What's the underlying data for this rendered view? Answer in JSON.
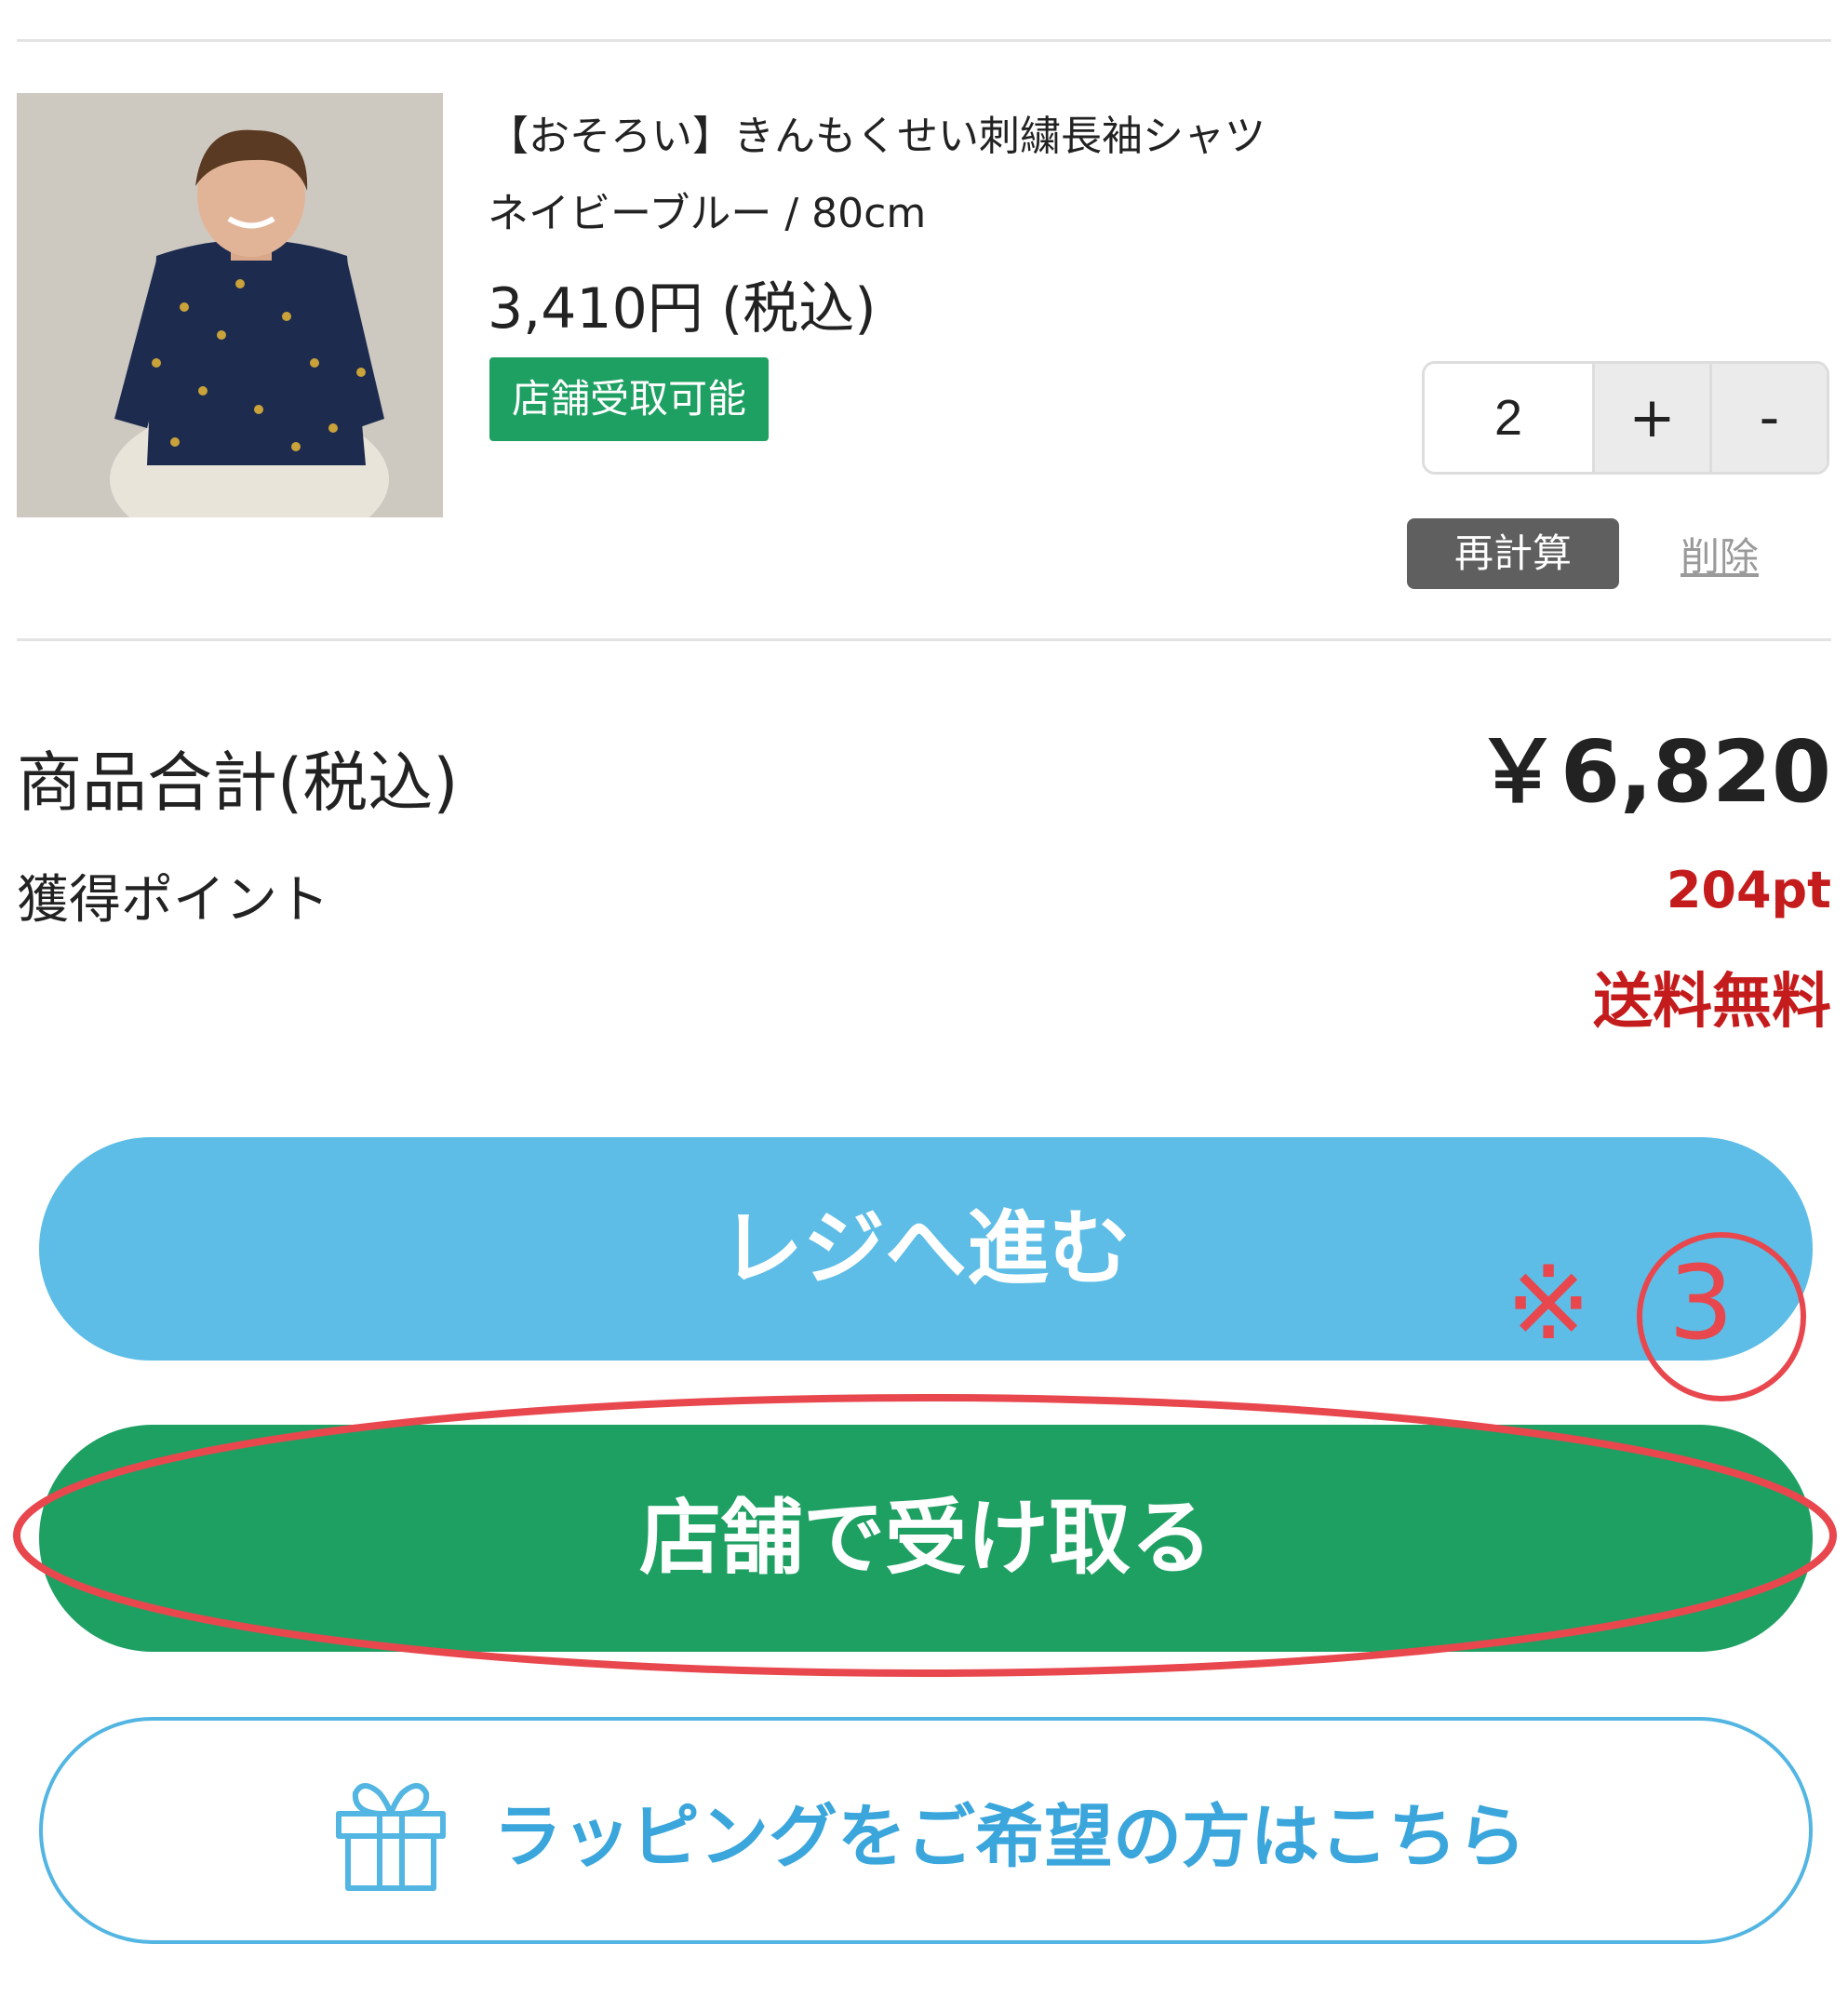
{
  "product": {
    "name": "【おそろい】きんもくせい刺繍長袖シャツ",
    "variant": "ネイビーブルー / 80cm",
    "price": "3,410円 (税込)",
    "badge": "店舗受取可能",
    "quantity": "2",
    "plus_label": "+",
    "minus_label": "-",
    "recalc_label": "再計算",
    "delete_label": "削除"
  },
  "summary": {
    "subtotal_label": "商品合計(税込)",
    "subtotal_value": "￥6,820",
    "points_label": "獲得ポイント",
    "points_value": "204pt",
    "shipping": "送料無料"
  },
  "actions": {
    "checkout_label": "レジへ進む",
    "store_pickup_label": "店舗で受け取る",
    "wrapping_label": "ラッピングをご希望の方はこちら"
  },
  "annotation": {
    "note_mark": "※",
    "number": "3"
  },
  "colors": {
    "green": "#1fa063",
    "blue": "#5dbde6",
    "red_text": "#c41c1c",
    "annotation_red": "#e8474e"
  }
}
